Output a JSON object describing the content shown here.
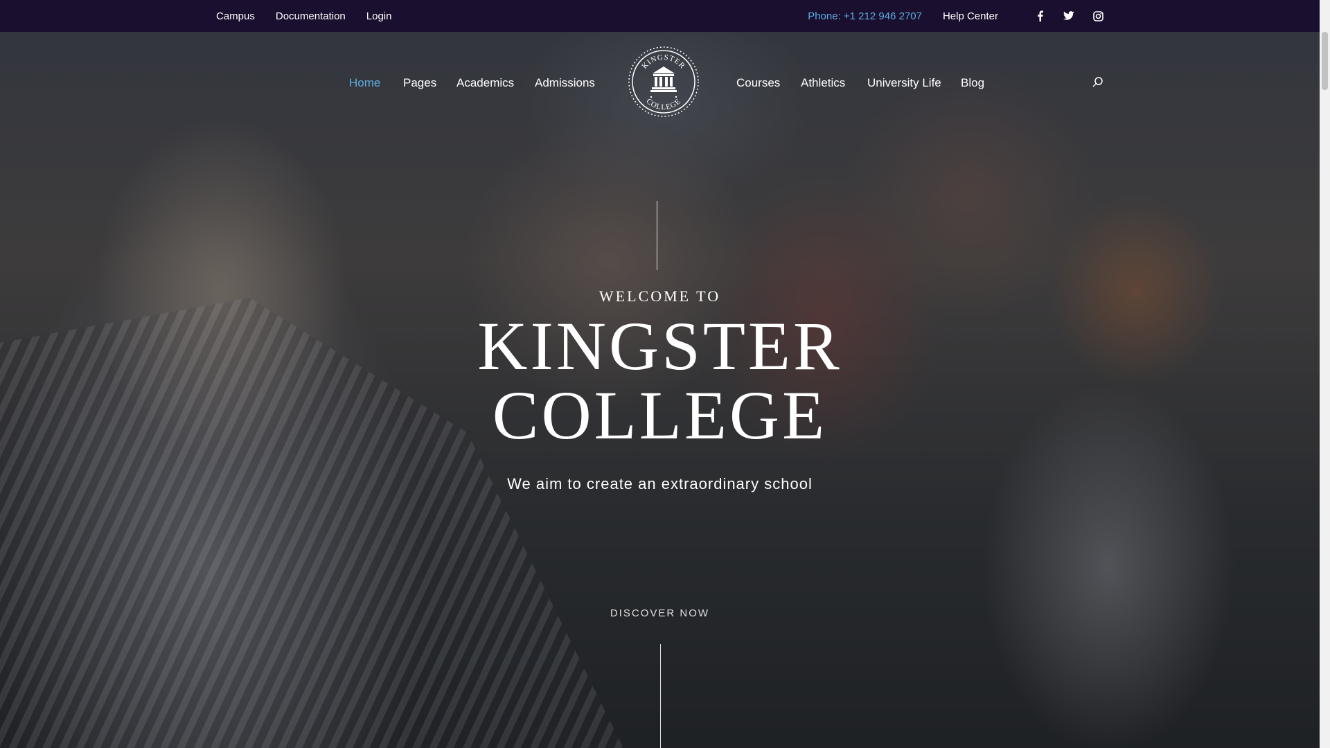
{
  "topbar": {
    "links": [
      "Campus",
      "Documentation",
      "Login"
    ],
    "phone": "Phone: +1 212 946 2707",
    "help": "Help Center",
    "social": [
      "facebook-icon",
      "twitter-icon",
      "instagram-icon"
    ]
  },
  "nav": {
    "left": [
      "Home",
      "Pages",
      "Academics",
      "Admissions"
    ],
    "right": [
      "Courses",
      "Athletics",
      "University Life",
      "Blog"
    ],
    "active": "Home"
  },
  "logo": {
    "line1": "KINGSTER",
    "line2": "COLLEGE"
  },
  "hero": {
    "welcome": "WELCOME TO",
    "title_line1": "KINGSTER",
    "title_line2": "COLLEGE",
    "tagline": "We aim to create an extraordinary school",
    "cta": "DISCOVER NOW"
  },
  "colors": {
    "topbar_bg": "#1a0f2e",
    "accent": "#5dade2"
  }
}
